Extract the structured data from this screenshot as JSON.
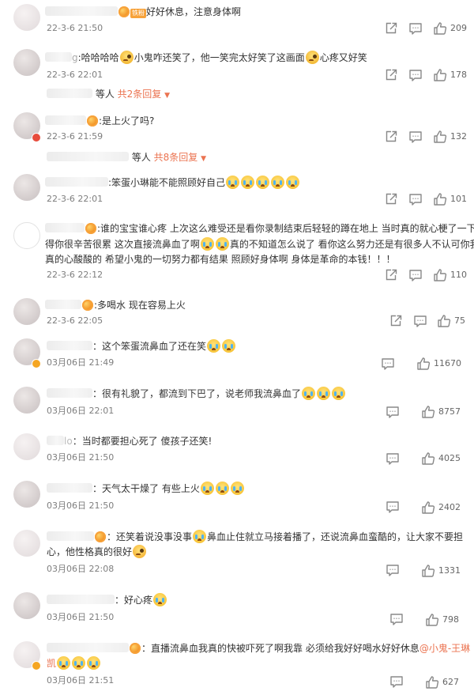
{
  "comments": [
    {
      "text": "好好休息，注意身体啊",
      "time": "22-3-6 21:50",
      "likes": "209"
    },
    {
      "pre": "哈哈哈哈",
      "mid": "小鬼咋还笑了，他一笑完太好笑了这画面",
      "end": "心疼又好笑",
      "time": "22-3-6 22:01",
      "likes": "178",
      "replies": {
        "prefix": "等人",
        "more": "共2条回复"
      }
    },
    {
      "text": "是上火了吗?",
      "time": "22-3-6 21:59",
      "likes": "132",
      "replies": {
        "prefix": "等人",
        "more": "共8条回复"
      }
    },
    {
      "text": "笨蛋小琳能不能照顾好自己",
      "time": "22-3-6 22:01",
      "likes": "101"
    },
    {
      "l1a": "谁的宝宝谁心疼 上次这么难受还是看你录制结束后轻轻的蹲在地上 当时真的就心梗了一下觉",
      "l2a": "得你很辛苦很累 这次直接流鼻血了啊",
      "l2b": "真的不知道怎么说了 看你这么努力还是有很多人不认可你我",
      "l3": "真的心酸酸的 希望小鬼的一切努力都有结果 照顾好身体啊 身体是革命的本钱！！！",
      "time": "22-3-6 22:12",
      "likes": "110"
    },
    {
      "text": "多喝水 现在容易上火",
      "time": "22-3-6 22:05",
      "likes": "75"
    },
    {
      "text": "：这个笨蛋流鼻血了还在笑",
      "time": "03月06日 21:49",
      "likes": "11670"
    },
    {
      "text": "：很有礼貌了，都流到下巴了，说老师我流鼻血了",
      "time": "03月06日 22:01",
      "likes": "8757"
    },
    {
      "text": "：当时都要担心死了 傻孩子还笑!",
      "time": "03月06日 21:50",
      "likes": "4025"
    },
    {
      "text": "：天气太干燥了 有些上火",
      "time": "03月06日 21:50",
      "likes": "2402"
    },
    {
      "l1a": "：还笑着说没事没事",
      "l1b": "鼻血止住就立马接着播了，还说流鼻血蛮酷的，让大家不要担",
      "l2": "心，他性格真的很好",
      "time": "03月06日 22:08",
      "likes": "1331"
    },
    {
      "text": "：好心疼",
      "time": "03月06日 21:50",
      "likes": "798"
    },
    {
      "l1": "：直播流鼻血我真的快被吓死了啊我靠 必须给我好好喝水好好休息",
      "mention": "@小鬼-王琳",
      "mention2": "凯",
      "time": "03月06日 21:51",
      "likes": "627"
    }
  ],
  "icons": {
    "share": "share-icon",
    "comment": "comment-icon",
    "like": "thumbs-up-icon"
  }
}
